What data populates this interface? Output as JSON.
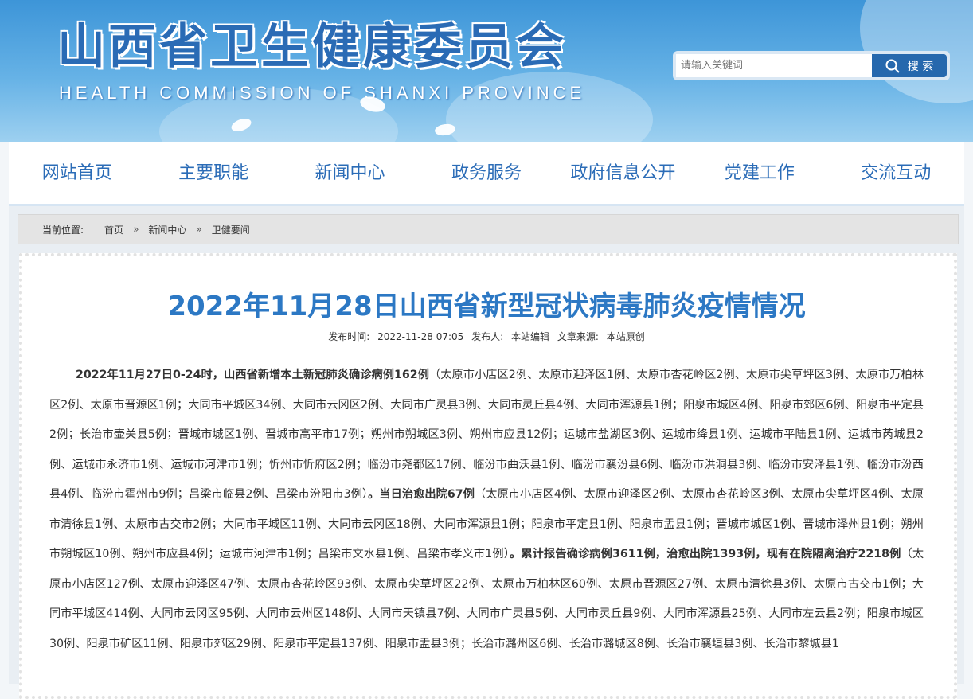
{
  "header": {
    "title": "山西省卫生健康委员会",
    "subtitle": "HEALTH COMMISSION OF SHANXI PROVINCE"
  },
  "search": {
    "placeholder": "请输入关键词",
    "button_label": "搜 索"
  },
  "nav": {
    "items": [
      "网站首页",
      "主要职能",
      "新闻中心",
      "政务服务",
      "政府信息公开",
      "党建工作",
      "交流互动"
    ]
  },
  "breadcrumb": {
    "label": "当前位置:",
    "items": [
      "首页",
      "新闻中心",
      "卫健要闻"
    ],
    "separator": "»"
  },
  "article": {
    "title": "2022年11月28日山西省新型冠状病毒肺炎疫情情况",
    "meta": {
      "date_label": "发布时间:",
      "date": "2022-11-28 07:05",
      "publisher_label": "发布人:",
      "publisher": "本站编辑",
      "source_label": "文章来源:",
      "source": "本站原创"
    },
    "segments": [
      {
        "bold": true,
        "text": "2022年11月27日0-24时，山西省新增本土新冠肺炎确诊病例162例"
      },
      {
        "bold": false,
        "text": "（太原市小店区2例、太原市迎泽区1例、太原市杏花岭区2例、太原市尖草坪区3例、太原市万柏林区2例、太原市晋源区1例；大同市平城区34例、大同市云冈区2例、大同市广灵县3例、大同市灵丘县4例、大同市浑源县1例；阳泉市城区4例、阳泉市郊区6例、阳泉市平定县2例；长治市壶关县5例；晋城市城区1例、晋城市高平市17例；朔州市朔城区3例、朔州市应县12例；运城市盐湖区3例、运城市绛县1例、运城市平陆县1例、运城市芮城县2例、运城市永济市1例、运城市河津市1例；忻州市忻府区2例；临汾市尧都区17例、临汾市曲沃县1例、临汾市襄汾县6例、临汾市洪洞县3例、临汾市安泽县1例、临汾市汾西县4例、临汾市霍州市9例；吕梁市临县2例、吕梁市汾阳市3例）"
      },
      {
        "bold": true,
        "text": "。当日治愈出院67例"
      },
      {
        "bold": false,
        "text": "（太原市小店区4例、太原市迎泽区2例、太原市杏花岭区3例、太原市尖草坪区4例、太原市清徐县1例、太原市古交市2例；大同市平城区11例、大同市云冈区18例、大同市浑源县1例；阳泉市平定县1例、阳泉市盂县1例；晋城市城区1例、晋城市泽州县1例；朔州市朔城区10例、朔州市应县4例；运城市河津市1例；吕梁市文水县1例、吕梁市孝义市1例）"
      },
      {
        "bold": true,
        "text": "。累计报告确诊病例3611例，治愈出院1393例，现有在院隔离治疗2218例"
      },
      {
        "bold": false,
        "text": "（太原市小店区127例、太原市迎泽区47例、太原市杏花岭区93例、太原市尖草坪区22例、太原市万柏林区60例、太原市晋源区27例、太原市清徐县3例、太原市古交市1例；大同市平城区414例、大同市云冈区95例、大同市云州区148例、大同市天镇县7例、大同市广灵县5例、大同市灵丘县9例、大同市浑源县25例、大同市左云县2例；阳泉市城区30例、阳泉市矿区11例、阳泉市郊区29例、阳泉市平定县137例、阳泉市盂县3例；长治市潞州区6例、长治市潞城区8例、长治市襄垣县3例、长治市黎城县1"
      }
    ]
  }
}
